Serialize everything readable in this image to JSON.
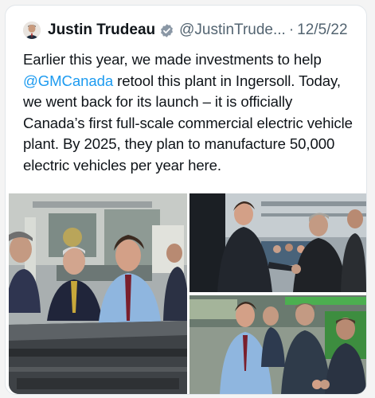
{
  "tweet": {
    "author_name": "Justin Trudeau",
    "handle": "@JustinTrude...",
    "separator": "·",
    "date": "12/5/22",
    "text_before": "Earlier this year, we made investments to help ",
    "mention": "@GMCanada",
    "text_after": " retool this plant in Ingersoll. Today, we went back for its launch – it is officially Canada’s first full-scale commercial electric vehicle plant. By 2025, they plan to manufacture 50,000 electric vehicles per year here."
  },
  "icons": {
    "verified": "verified-badge-icon",
    "avatar": "profile-avatar"
  },
  "colors": {
    "link": "#1d9bf0",
    "text": "#0f1419",
    "muted": "#536471"
  },
  "media": {
    "count": 3
  }
}
